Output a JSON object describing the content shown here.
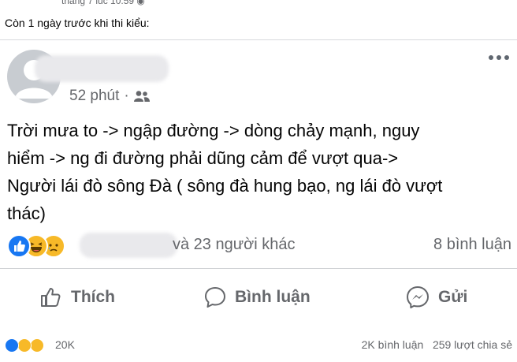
{
  "outer_post": {
    "meta_time": "tháng 7 lúc 10:59",
    "caption": "Còn 1 ngày trước khi thi kiểu:",
    "reaction_count": "20K",
    "comments": "2K bình luận",
    "shares": "259 lượt chia sẻ"
  },
  "screenshot_post": {
    "time": "52 phút",
    "audience_icon": "friends-icon",
    "text_lines": [
      "Trời mưa to -> ngập đường -> dòng chảy mạnh, nguy",
      "hiểm -> ng đi đường phải dũng cảm để vượt qua->",
      "Người lái đò sông Đà ( sông đà hung bạo, ng lái đò vượt",
      "thác)"
    ],
    "reactions_text": "và 23 người khác",
    "comment_count": "8 bình luận",
    "actions": {
      "like": "Thích",
      "comment": "Bình luận",
      "share": "Gửi"
    }
  },
  "colors": {
    "facebook_blue": "#1877f2",
    "reaction_yellow": "#f7b928",
    "secondary_text": "#65676b"
  }
}
